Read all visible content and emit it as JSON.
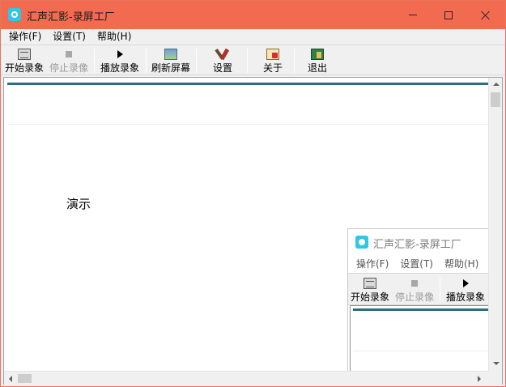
{
  "window": {
    "title": "汇声汇影-录屏工厂",
    "accent": "#f26b51"
  },
  "menu": {
    "items": [
      {
        "label": "操作(F)"
      },
      {
        "label": "设置(T)"
      },
      {
        "label": "帮助(H)"
      }
    ]
  },
  "toolbar": {
    "start_record": "开始录象",
    "stop_record": "停止录像",
    "play_record": "播放录象",
    "refresh_screen": "刷新屏幕",
    "settings": "设置",
    "about": "关于",
    "exit": "退出"
  },
  "canvas": {
    "demo_text": "演示"
  },
  "nested_window": {
    "title": "汇声汇影-录屏工厂",
    "menu": [
      "操作(F)",
      "设置(T)",
      "帮助(H)"
    ],
    "toolbar": {
      "start_record": "开始录象",
      "stop_record": "停止录像",
      "play_record": "播放录象"
    }
  }
}
